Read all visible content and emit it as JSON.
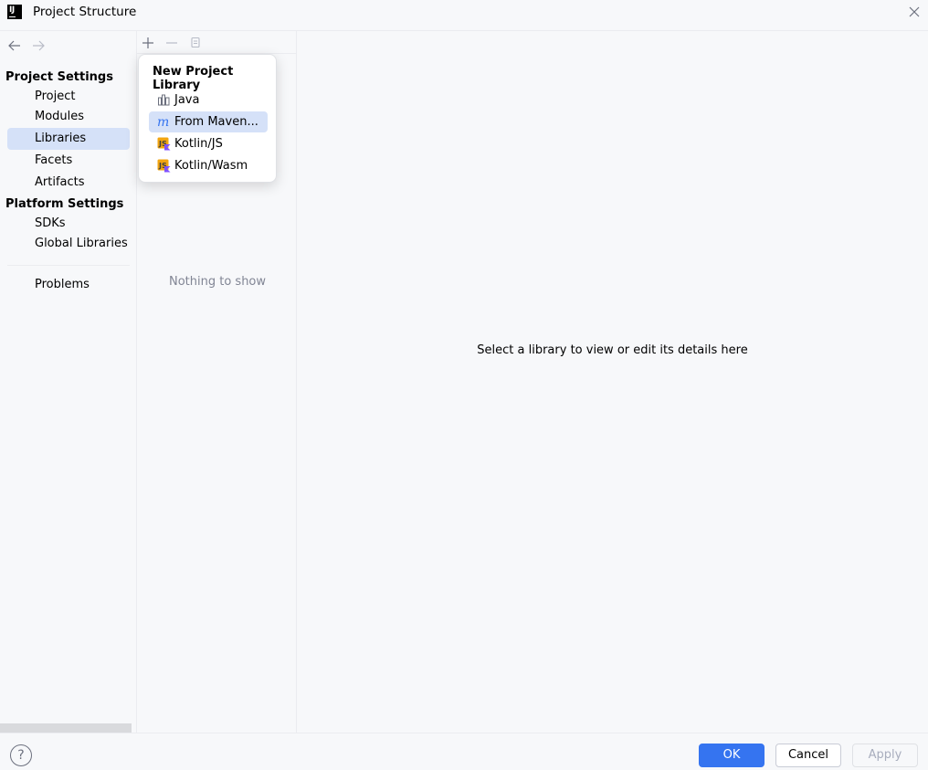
{
  "window": {
    "title": "Project Structure",
    "logo_text": "IJ"
  },
  "sidebar": {
    "project_settings_title": "Project Settings",
    "project_items": [
      {
        "label": "Project"
      },
      {
        "label": "Modules"
      },
      {
        "label": "Libraries",
        "selected": true
      },
      {
        "label": "Facets"
      },
      {
        "label": "Artifacts"
      }
    ],
    "platform_settings_title": "Platform Settings",
    "platform_items": [
      {
        "label": "SDKs"
      },
      {
        "label": "Global Libraries"
      }
    ],
    "problems_label": "Problems"
  },
  "libraries_pane": {
    "empty_text": "Nothing to show"
  },
  "details": {
    "placeholder": "Select a library to view or edit its details here"
  },
  "popup": {
    "title": "New Project Library",
    "items": [
      {
        "label": "Java",
        "icon": "library-icon"
      },
      {
        "label": "From Maven...",
        "icon": "maven-icon",
        "selected": true
      },
      {
        "label": "Kotlin/JS",
        "icon": "kotlin-js-icon"
      },
      {
        "label": "Kotlin/Wasm",
        "icon": "kotlin-wasm-icon"
      }
    ]
  },
  "footer": {
    "help_label": "?",
    "ok_label": "OK",
    "cancel_label": "Cancel",
    "apply_label": "Apply"
  },
  "colors": {
    "accent": "#3574f0",
    "selection": "#d5e1f8",
    "background": "#f7f8fa"
  }
}
